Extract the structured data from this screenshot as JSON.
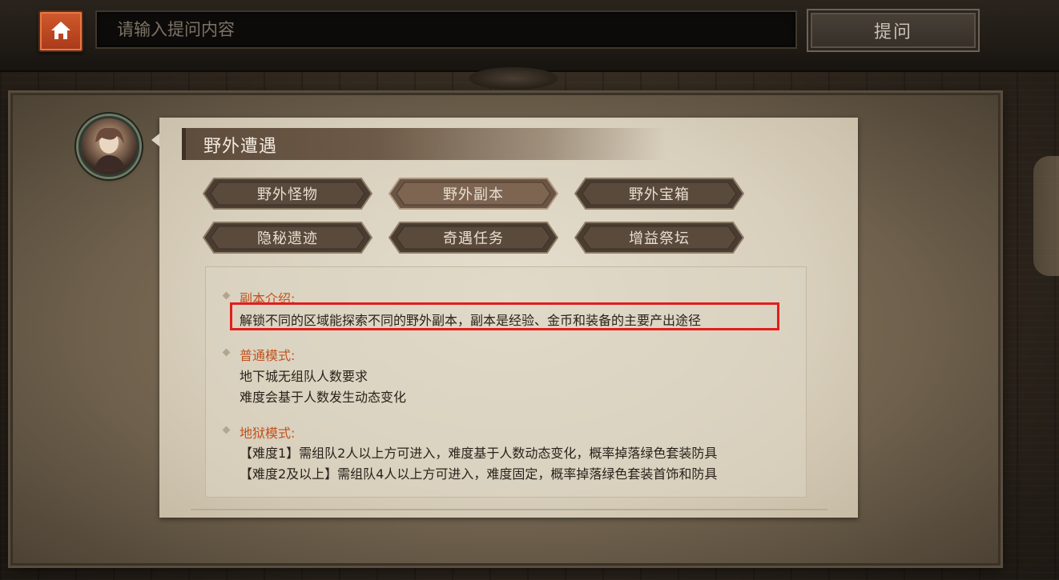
{
  "topbar": {
    "search": {
      "placeholder": "请输入提问内容",
      "value": ""
    },
    "ask_label": "提问"
  },
  "panel": {
    "title": "野外遭遇",
    "tabs": [
      {
        "label": "野外怪物",
        "selected": false
      },
      {
        "label": "野外副本",
        "selected": true
      },
      {
        "label": "野外宝箱",
        "selected": false
      },
      {
        "label": "隐秘遗迹",
        "selected": false
      },
      {
        "label": "奇遇任务",
        "selected": false
      },
      {
        "label": "增益祭坛",
        "selected": false
      }
    ],
    "sections": [
      {
        "heading": "副本介绍:",
        "lines": [
          "解锁不同的区域能探索不同的野外副本，副本是经验、金币和装备的主要产出途径"
        ]
      },
      {
        "heading": "普通模式:",
        "lines": [
          "地下城无组队人数要求",
          "难度会基于人数发生动态变化"
        ]
      },
      {
        "heading": "地狱模式:",
        "lines": [
          "【难度1】需组队2人以上方可进入，难度基于人数动态变化，概率掉落绿色套装防具",
          "【难度2及以上】需组队4人以上方可进入，难度固定，概率掉落绿色套装首饰和防具"
        ]
      }
    ]
  },
  "colors": {
    "accent": "#c0521f",
    "highlight": "#e21d1d",
    "home": "#c24a22"
  },
  "icons": {
    "home": "home-icon",
    "avatar": "character-portrait"
  }
}
